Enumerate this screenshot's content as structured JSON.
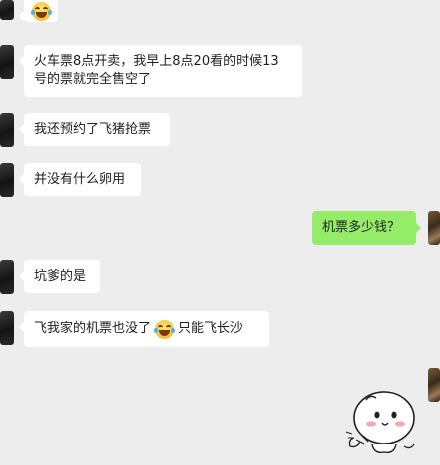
{
  "chat": {
    "messages": [
      {
        "side": "left",
        "emoji_only": "laughing-tears-emoji"
      },
      {
        "side": "left",
        "lines": [
          "火车票8点开卖，我早上8点20看的时候13",
          "号的票就完全售空了"
        ]
      },
      {
        "side": "left",
        "text": "我还预约了飞猪抢票"
      },
      {
        "side": "left",
        "text": "并没有什么卵用"
      },
      {
        "side": "right",
        "text": "机票多少钱？"
      },
      {
        "side": "left",
        "text": "坑爹的是"
      },
      {
        "side": "left",
        "text_before": "飞我家的机票也没了",
        "emoji": "laughing-tears-emoji",
        "text_after": "只能飞长沙"
      },
      {
        "side": "right",
        "sticker": "dumpling-sticker"
      }
    ]
  },
  "colors": {
    "background": "#ededed",
    "incoming_bubble": "#ffffff",
    "outgoing_bubble": "#95ec69"
  }
}
